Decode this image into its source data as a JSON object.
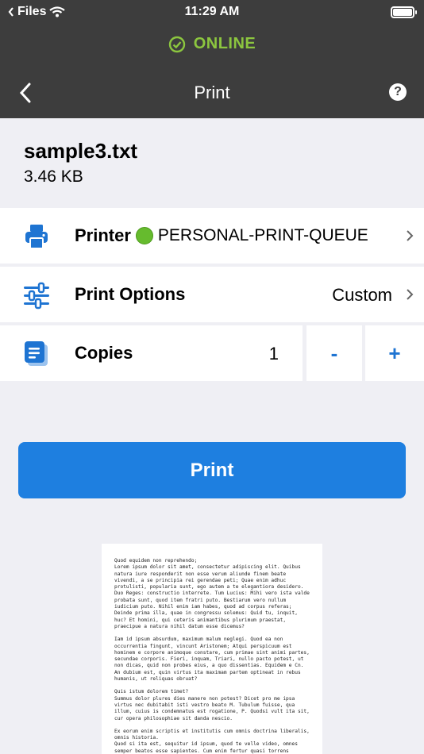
{
  "status_bar": {
    "back_app": "Files",
    "time": "11:29 AM"
  },
  "connection": {
    "label": "ONLINE",
    "color": "#8cc63f"
  },
  "nav": {
    "title": "Print",
    "back_icon": "chevron-left-icon",
    "help_icon": "question-icon",
    "help_glyph": "?"
  },
  "file": {
    "name": "sample3.txt",
    "size": "3.46 KB"
  },
  "printer": {
    "label": "Printer",
    "queue": "PERSONAL-PRINT-QUEUE",
    "status_color": "#66bb2e"
  },
  "print_options": {
    "label": "Print Options",
    "value": "Custom"
  },
  "copies": {
    "label": "Copies",
    "value": "1",
    "minus": "-",
    "plus": "+"
  },
  "print_button": {
    "label": "Print",
    "color": "#1e7fe0"
  },
  "preview": {
    "paragraphs": [
      "Quod equidem non reprehendo;\nLorem ipsum dolor sit amet, consectetur adipiscing elit. Quibus natura iure responderit non esse verum aliunde finem beate vivendi, a se principia rei gerendae peti; Quae enim adhuc protulisti, popularia sunt, ego autem a te elegantiora desidero. Duo Reges: constructio interrete. Tum Lucius: Mihi vero ista valde probata sunt, quod item fratri puto. Bestiarum vero nullum iudicium puto. Nihil enim iam habes, quod ad corpus referas; Deinde prima illa, quae in congressu solemus: Quid tu, inquit, huc? Et homini, qui ceteris animantibus plurimum praestat, praecipue a natura nihil datum esse dicemus?",
      "Iam id ipsum absurdum, maximum malum neglegi. Quod ea non occurrentia fingunt, vincunt Aristonem; Atqui perspicuum est hominem e corpore animoque constare, cum primae sint animi partes, secundae corporis. Fieri, inquam, Triari, nullo pacto potest, ut non dicas, quid non probes eius, a quo dissentias. Equidem e Cn. An dubium est, quin virtus ita maximam partem optineat in rebus humanis, ut reliquas obruat?",
      "Quis istum dolorem timet?\nSummus dolor plures dies manere non potest? Dicet pro me ipsa virtus nec dubitabit isti vestro beato M. Tubulum fuisse, qua illum, cuius is condemnatus est rogatione, P. Quodsi vult ita sit, cur opera philosophiae sit danda nescio.",
      "Ex eorum enim scriptis et institutis cum omnis doctrina liberalis, omnis historia.\nQuod si ita est, sequitur id ipsum, quod te velle video, omnes semper beatos esse sapientes. Cum enim fertur quasi torrens oratio, quamvis multa cuiusque modi rapiat, nihil tamen teneas, nihil apprehendas, nusquam orationem rapidam coerceas. Ita redarguitur ipse a sese, convincunturque scripta eius probitate ipsius ac moribus."
    ]
  }
}
